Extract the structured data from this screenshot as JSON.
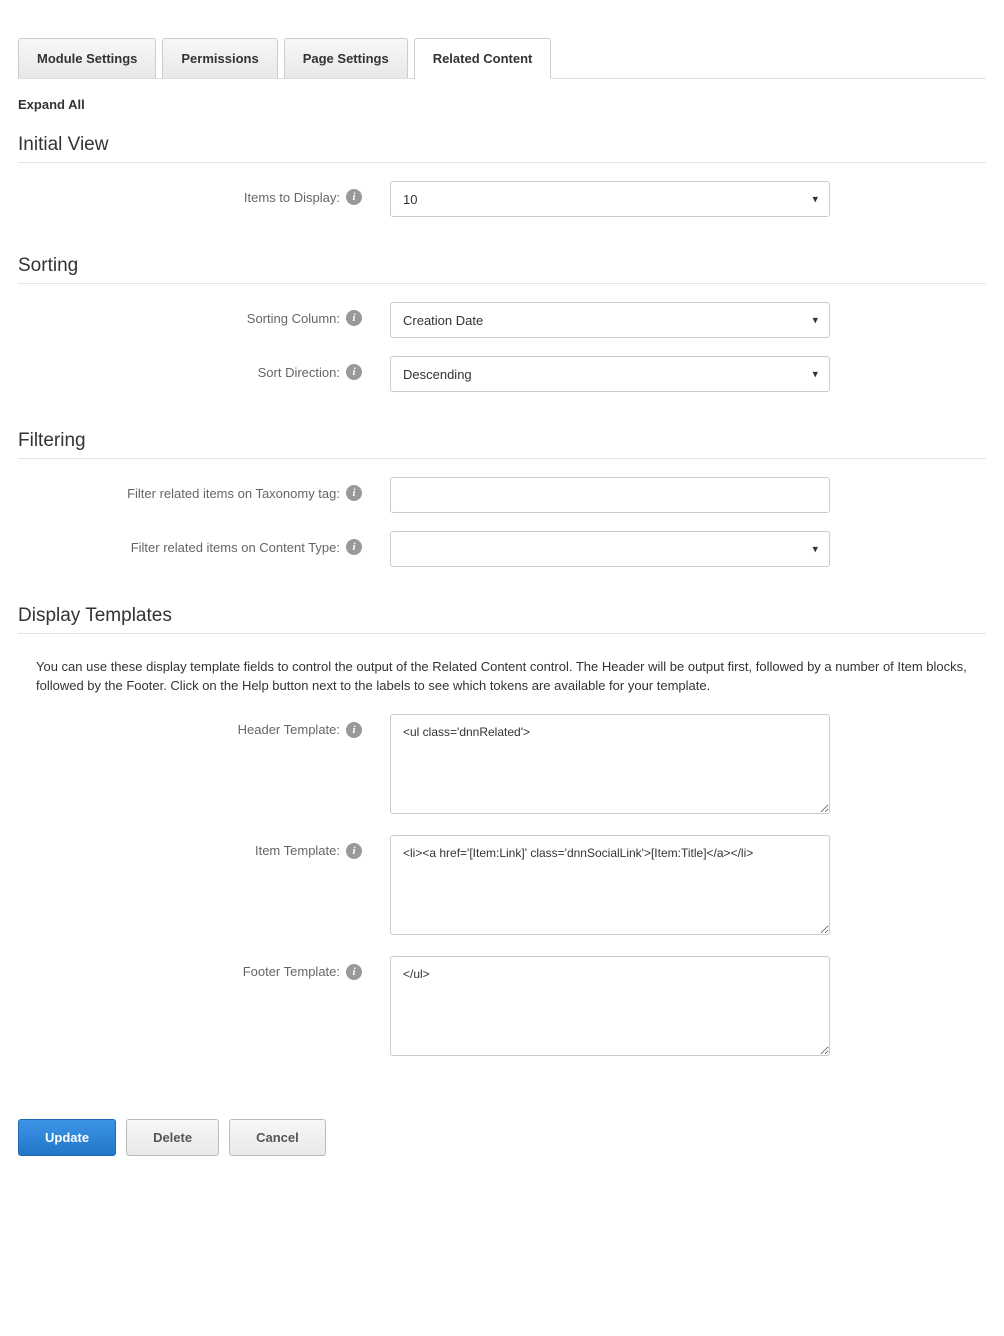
{
  "tabs": [
    {
      "label": "Module Settings"
    },
    {
      "label": "Permissions"
    },
    {
      "label": "Page Settings"
    },
    {
      "label": "Related Content"
    }
  ],
  "expand_all": "Expand All",
  "sections": {
    "initial_view": {
      "title": "Initial View",
      "items_to_display": {
        "label": "Items to Display:",
        "value": "10"
      }
    },
    "sorting": {
      "title": "Sorting",
      "sorting_column": {
        "label": "Sorting Column:",
        "value": "Creation Date"
      },
      "sort_direction": {
        "label": "Sort Direction:",
        "value": "Descending"
      }
    },
    "filtering": {
      "title": "Filtering",
      "taxonomy": {
        "label": "Filter related items on Taxonomy tag:",
        "value": ""
      },
      "content_type": {
        "label": "Filter related items on Content Type:",
        "value": ""
      }
    },
    "display_templates": {
      "title": "Display Templates",
      "info": "You can use these display template fields to control the output of the Related Content control. The Header will be output first, followed by a number of Item blocks, followed by the Footer. Click on the Help button next to the labels to see which tokens are available for your template.",
      "header_template": {
        "label": "Header Template:",
        "value": "<ul class='dnnRelated'>"
      },
      "item_template": {
        "label": "Item Template:",
        "value": "<li><a href='[Item:Link]' class='dnnSocialLink'>[Item:Title]</a></li>"
      },
      "footer_template": {
        "label": "Footer Template:",
        "value": "</ul>"
      }
    }
  },
  "buttons": {
    "update": "Update",
    "delete": "Delete",
    "cancel": "Cancel"
  }
}
